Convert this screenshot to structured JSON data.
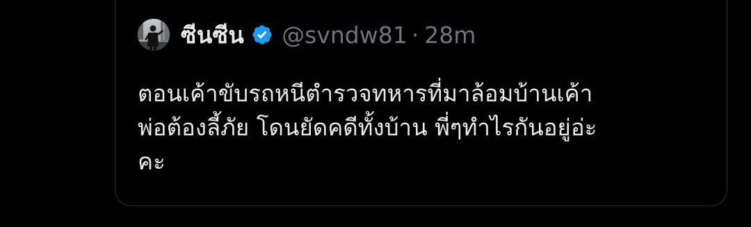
{
  "quote": {
    "author": {
      "display_name": "ซีนซีน",
      "handle": "@svndw81",
      "separator": "·",
      "time": "28m",
      "verified": true,
      "verified_color": "#1d9bf0"
    },
    "text_lines": [
      "ตอนเค้าขับรถหนีตำรวจทหารที่มาล้อมบ้านเค้า",
      "พ่อต้องลี้ภัย โดนยัดคดีทั้งบ้าน พี่ๆทำไรกันอยู่อ่ะ",
      "คะ"
    ]
  },
  "colors": {
    "background": "#000000",
    "text": "#e7e9ea",
    "secondary_text": "#71767b",
    "border": "#2f3336"
  }
}
